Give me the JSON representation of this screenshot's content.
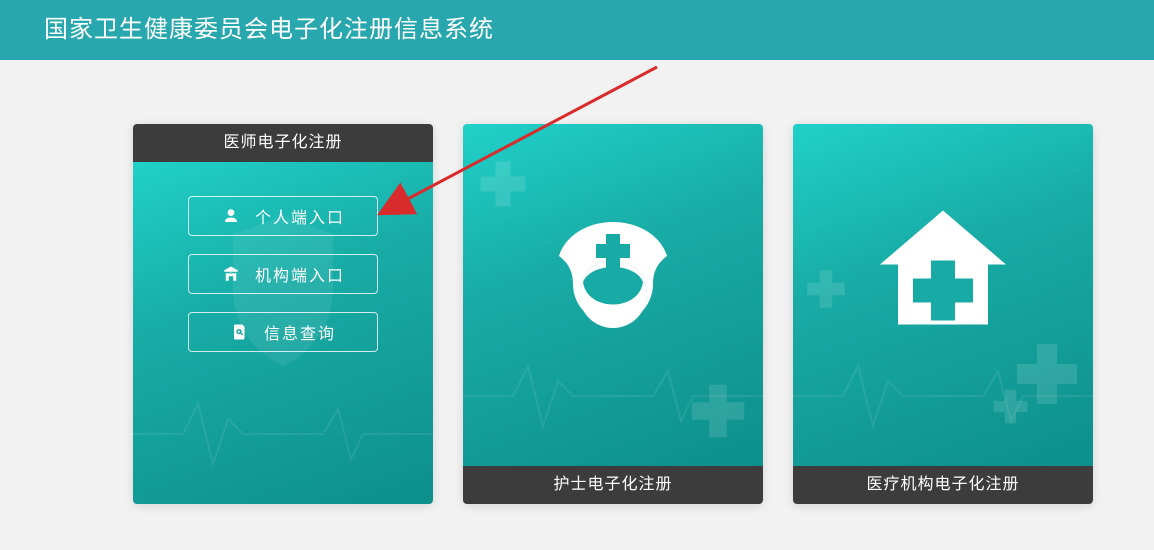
{
  "header": {
    "title": "国家卫生健康委员会电子化注册信息系统"
  },
  "cards": {
    "doctor": {
      "title": "医师电子化注册",
      "buttons": {
        "personal_entry": "个人端入口",
        "institution_entry": "机构端入口",
        "info_query": "信息查询"
      }
    },
    "nurse": {
      "title": "护士电子化注册"
    },
    "institution": {
      "title": "医疗机构电子化注册"
    }
  },
  "colors": {
    "brand": "#28a8ae",
    "card_header": "#3c3c3c",
    "teal_light": "#20d1c8",
    "teal_dark": "#0e8f8b",
    "annotation": "#d92b2b",
    "page_bg": "#f2f2f2"
  },
  "icons": {
    "user": "user-icon",
    "institution": "institution-icon",
    "search": "search-icon",
    "shield_cross": "shield-cross-icon",
    "nurse_cap": "nurse-cap-icon",
    "medical_house": "medical-house-icon",
    "plus": "plus-icon",
    "heartbeat": "heartbeat-icon"
  }
}
